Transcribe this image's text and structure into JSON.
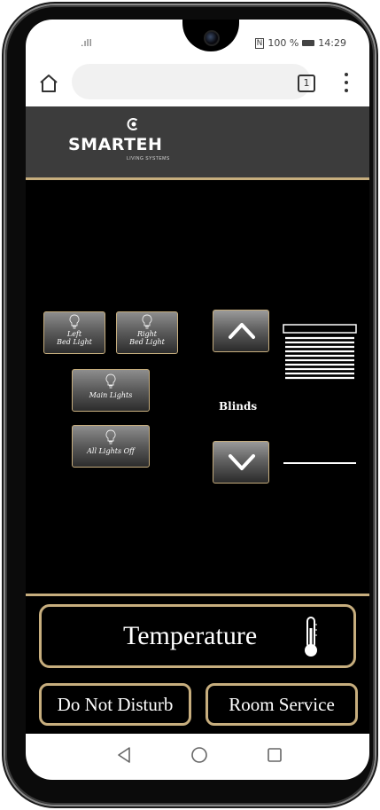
{
  "status": {
    "signal": ".ıll",
    "nfc": "N",
    "battery": "100 %",
    "time": "14:29"
  },
  "browser": {
    "tab_count": "1"
  },
  "brand": {
    "name": "SMARTEH",
    "tagline": "LIVING SYSTEMS",
    "accent": "#c7ae7e"
  },
  "lights": {
    "left_bed": "Left\nBed Light",
    "right_bed": "Right\nBed Light",
    "main": "Main Lights",
    "all_off": "All Lights Off"
  },
  "blinds": {
    "label": "Blinds",
    "up_icon": "chevron-up-icon",
    "down_icon": "chevron-down-icon"
  },
  "controls": {
    "temperature": "Temperature",
    "do_not_disturb": "Do Not Disturb",
    "room_service": "Room Service"
  }
}
